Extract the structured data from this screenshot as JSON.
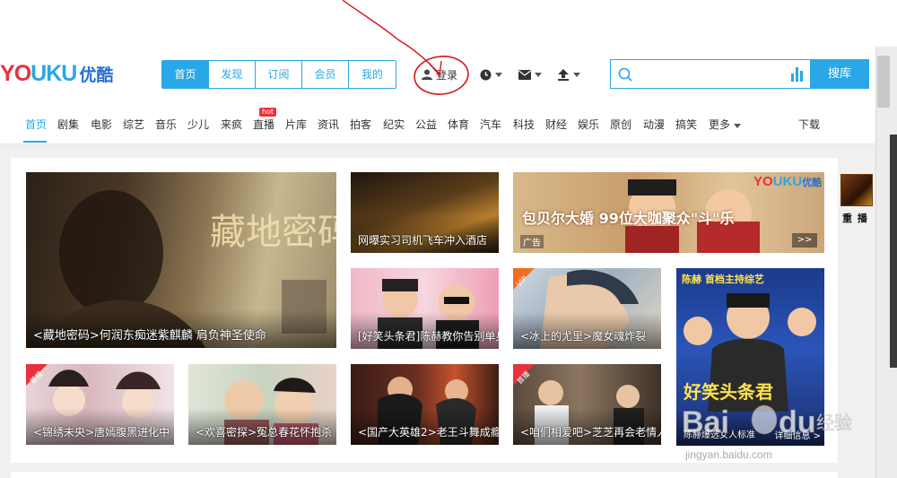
{
  "header": {
    "logo_en": "YOUKU",
    "logo_cn": "优酷",
    "main_nav": [
      {
        "label": "首页",
        "active": true
      },
      {
        "label": "发现",
        "active": false
      },
      {
        "label": "订阅",
        "active": false
      },
      {
        "label": "会员",
        "active": false
      },
      {
        "label": "我的",
        "active": false
      }
    ],
    "login_label": "登录",
    "tool_icons": [
      "clock-icon",
      "mail-icon",
      "upload-icon"
    ],
    "search": {
      "value": "",
      "placeholder": "",
      "button_label": "搜库"
    }
  },
  "channels": {
    "items": [
      "首页",
      "剧集",
      "电影",
      "综艺",
      "音乐",
      "少儿",
      "来疯",
      "直播",
      "片库",
      "资讯",
      "拍客",
      "纪实",
      "公益",
      "体育",
      "汽车",
      "科技",
      "财经",
      "娱乐",
      "原创",
      "动漫",
      "搞笑",
      "更多"
    ],
    "hot_badge": "hot",
    "download_label": "下载"
  },
  "tiles": {
    "big": "<藏地密码>何润东痴迷紫麒麟 肩负神圣使命",
    "t1": "网曝实习司机飞车冲入酒店",
    "t2": "包贝尔大婚",
    "t3": "[好笑头条君]陈赫教你告别单身",
    "t4": "<冰上的尤里>魔女魂炸裂",
    "t5": "陈赫爆选女人标准",
    "t5_more": "详细信息 >",
    "t6": "<锦绣未央>唐嫣腹黑进化中",
    "t7": "<欢喜密探>冤总春花怀抱杀",
    "t8": "<国产大英雄2>老王斗舞成瘾",
    "t9": "<咱们相爱吧>芝芝再会老情人",
    "banner_caption": "包贝尔大婚 99位大咖聚众\"斗\"乐",
    "banner_left_tag": "广告",
    "banner_next": ">>",
    "tag_vip": "VIP",
    "tag_premiere": "首播"
  },
  "side": {
    "label": "重 播"
  },
  "watermark": {
    "text": "jingyan.baidu.com"
  },
  "colors": {
    "accent": "#2aa7e6",
    "brand_red": "#e8313c",
    "annotation": "#d9141b"
  }
}
